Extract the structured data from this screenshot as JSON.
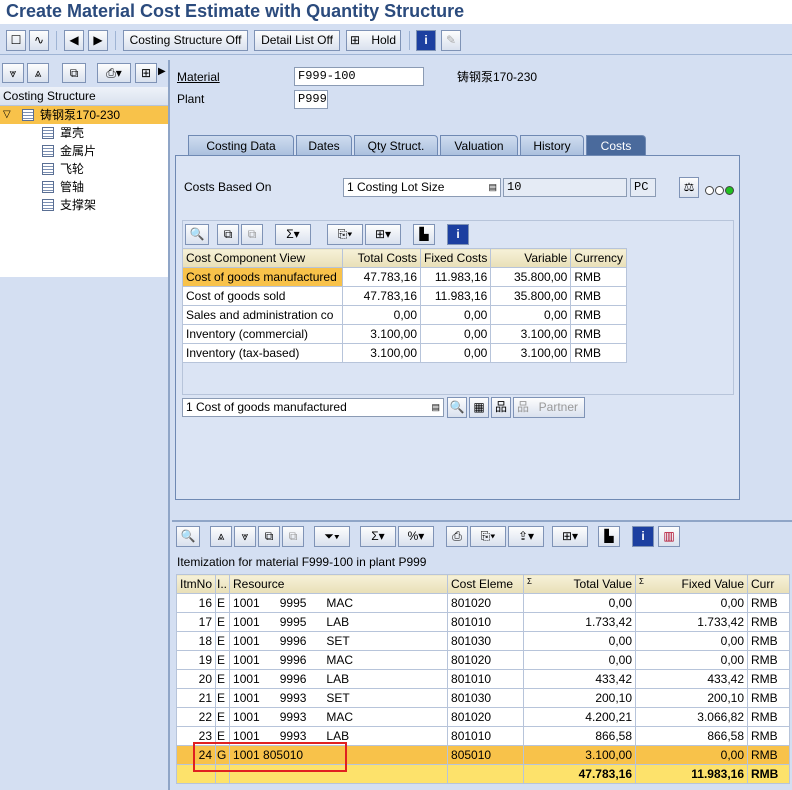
{
  "title": "Create Material Cost Estimate with Quantity Structure",
  "toolbar": {
    "costing_structure_off": "Costing Structure Off",
    "detail_list_off": "Detail List Off",
    "hold": "Hold"
  },
  "tree": {
    "header": "Costing Structure",
    "root": "铸钢泵170-230",
    "children": [
      "罩壳",
      "金属片",
      "飞轮",
      "管轴",
      "支撑架"
    ]
  },
  "header_fields": {
    "material_label": "Material",
    "material_value": "F999-100",
    "material_desc": "铸钢泵170-230",
    "plant_label": "Plant",
    "plant_value": "P999"
  },
  "tabs": [
    "Costing Data",
    "Dates",
    "Qty Struct.",
    "Valuation",
    "History",
    "Costs"
  ],
  "costs": {
    "based_on_label": "Costs Based On",
    "based_on_value": "1 Costing Lot Size",
    "lot_size": "10",
    "unit": "PC",
    "bottom_select": "1 Cost of goods manufactured",
    "partner_label": "Partner"
  },
  "cost_table": {
    "headers": [
      "Cost Component View",
      "Total Costs",
      "Fixed Costs",
      "Variable",
      "Currency"
    ],
    "rows": [
      [
        "Cost of goods manufactured",
        "47.783,16",
        "11.983,16",
        "35.800,00",
        "RMB"
      ],
      [
        "Cost of goods sold",
        "47.783,16",
        "11.983,16",
        "35.800,00",
        "RMB"
      ],
      [
        "Sales and administration co",
        "0,00",
        "0,00",
        "0,00",
        "RMB"
      ],
      [
        "Inventory (commercial)",
        "3.100,00",
        "0,00",
        "3.100,00",
        "RMB"
      ],
      [
        "Inventory (tax-based)",
        "3.100,00",
        "0,00",
        "3.100,00",
        "RMB"
      ]
    ]
  },
  "itemization": {
    "caption": "Itemization for material F999-100 in plant P999",
    "headers": [
      "ItmNo",
      "I..",
      "Resource",
      "Cost Eleme",
      "Total Value",
      "Fixed Value",
      "Curr"
    ],
    "sum_marker": "Σ",
    "rows": [
      [
        "16",
        "E",
        "1001      9995      MAC",
        "801020",
        "0,00",
        "0,00",
        "RMB"
      ],
      [
        "17",
        "E",
        "1001      9995      LAB",
        "801010",
        "1.733,42",
        "1.733,42",
        "RMB"
      ],
      [
        "18",
        "E",
        "1001      9996      SET",
        "801030",
        "0,00",
        "0,00",
        "RMB"
      ],
      [
        "19",
        "E",
        "1001      9996      MAC",
        "801020",
        "0,00",
        "0,00",
        "RMB"
      ],
      [
        "20",
        "E",
        "1001      9996      LAB",
        "801010",
        "433,42",
        "433,42",
        "RMB"
      ],
      [
        "21",
        "E",
        "1001      9993      SET",
        "801030",
        "200,10",
        "200,10",
        "RMB"
      ],
      [
        "22",
        "E",
        "1001      9993      MAC",
        "801020",
        "4.200,21",
        "3.066,82",
        "RMB"
      ],
      [
        "23",
        "E",
        "1001      9993      LAB",
        "801010",
        "866,58",
        "866,58",
        "RMB"
      ],
      [
        "24",
        "G",
        "1001 805010",
        "805010",
        "3.100,00",
        "0,00",
        "RMB"
      ]
    ],
    "total": {
      "total_value": "47.783,16",
      "fixed_value": "11.983,16",
      "curr": "RMB"
    }
  },
  "colors": {
    "highlight": "#f8c24a",
    "total_row": "#fde26b",
    "annotation_box": "#e02020",
    "title": "#2b4b7d"
  }
}
